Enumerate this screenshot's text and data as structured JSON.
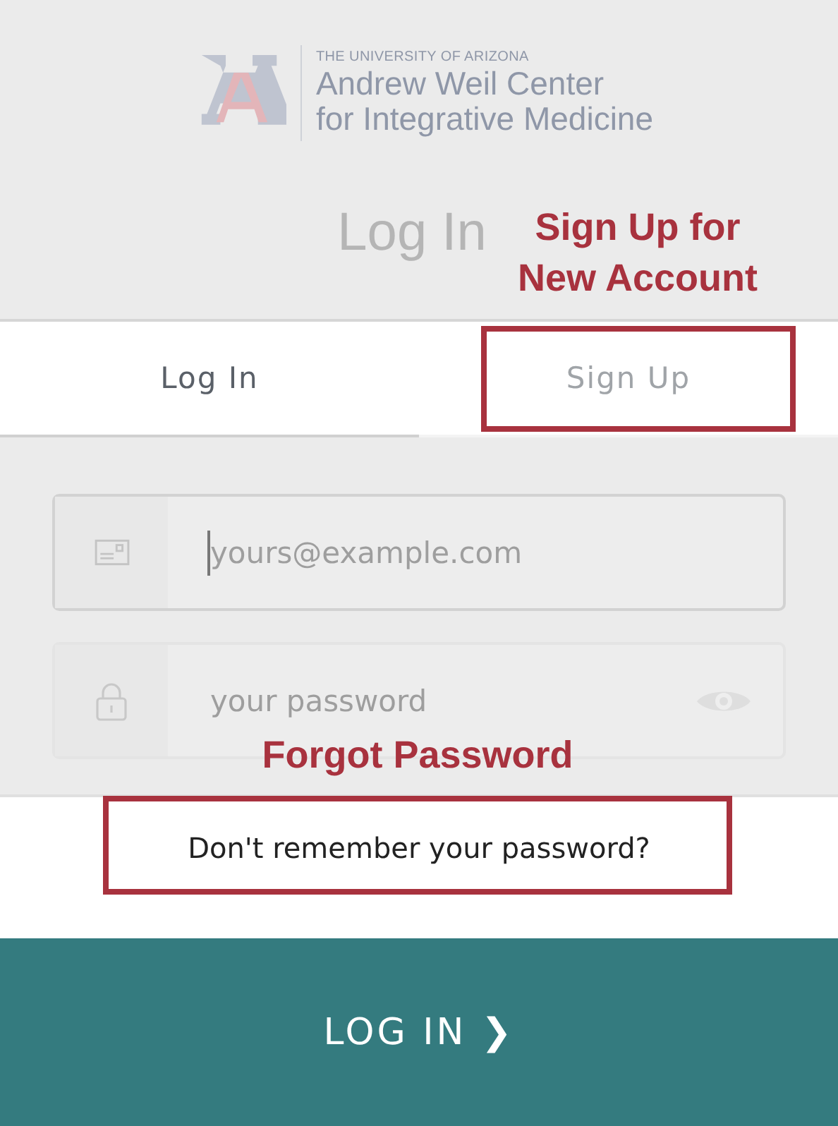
{
  "logo": {
    "university": "THE UNIVERSITY OF ARIZONA",
    "name_line_1": "Andrew Weil Center",
    "name_line_2": "for Integrative Medicine"
  },
  "title": "Log In",
  "tabs": [
    {
      "label": "Log In",
      "selected": true
    },
    {
      "label": "Sign Up",
      "selected": false
    }
  ],
  "fields": [
    {
      "kind": "email",
      "placeholder": "yours@example.com",
      "focused": true
    },
    {
      "kind": "password",
      "placeholder": "your password",
      "focused": false
    }
  ],
  "forgot_link": "Don't remember your password?",
  "submit_button": {
    "label": "LOG IN",
    "arrow": "❯"
  },
  "annotations": [
    {
      "text": "Sign Up for New Account"
    },
    {
      "text": "Forgot Password"
    }
  ]
}
